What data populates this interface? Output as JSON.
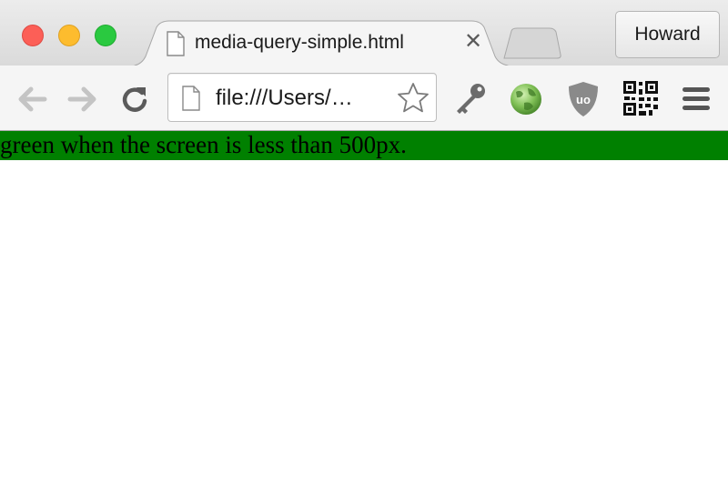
{
  "window": {
    "traffic_lights": [
      "close",
      "minimize",
      "maximize"
    ]
  },
  "tab": {
    "title": "media-query-simple.html",
    "close_glyph": "✕",
    "icon": "document-icon"
  },
  "profile": {
    "label": "Howard"
  },
  "toolbar": {
    "back_icon": "back-arrow-icon",
    "forward_icon": "forward-arrow-icon",
    "reload_icon": "reload-icon",
    "url": "file:///Users/…",
    "bookmark_icon": "star-icon",
    "extensions": [
      "key-icon",
      "globe-icon",
      "ublock-shield-icon",
      "qr-code-icon"
    ],
    "menu_icon": "hamburger-menu-icon"
  },
  "page": {
    "text": "green when the screen is less than 500px.",
    "background": "#008000"
  }
}
